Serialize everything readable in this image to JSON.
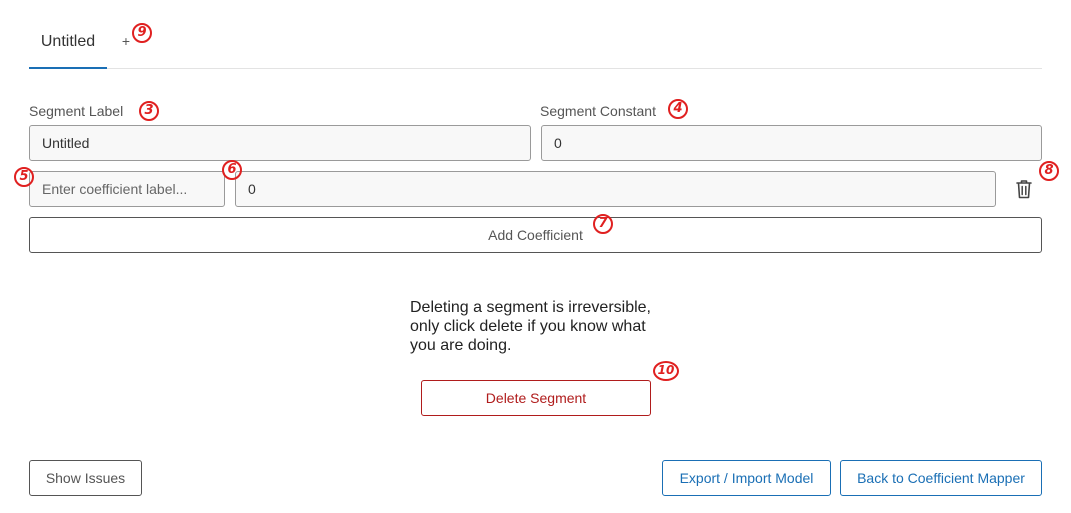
{
  "tabs": {
    "items": [
      {
        "label": "Untitled",
        "active": true
      }
    ],
    "add_label": "+"
  },
  "segment_label": {
    "label": "Segment Label",
    "value": "Untitled"
  },
  "segment_constant": {
    "label": "Segment Constant",
    "value": "0"
  },
  "coefficient": {
    "label_placeholder": "Enter coefficient label...",
    "label_value": "",
    "value": "0",
    "delete_icon": "trash-icon"
  },
  "actions": {
    "add_coefficient": "Add Coefficient",
    "delete_segment": "Delete Segment",
    "show_issues": "Show Issues",
    "export_import": "Export / Import Model",
    "back": "Back to Coefficient Mapper"
  },
  "warning_text": "Deleting a segment is irreversible, only click delete if you know what you are doing.",
  "annotations": {
    "m3": "3",
    "m4": "4",
    "m5": "5",
    "m6": "6",
    "m7": "7",
    "m8": "8",
    "m9": "9",
    "m10": "10"
  },
  "colors": {
    "accent": "#1a6fb5",
    "danger": "#b01c1c",
    "annotation": "#e02020"
  }
}
